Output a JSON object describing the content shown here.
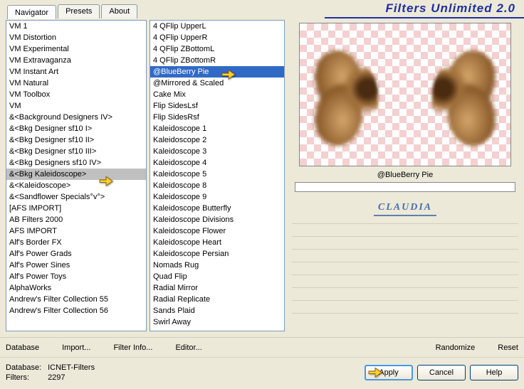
{
  "title": "Filters Unlimited 2.0",
  "tabs": [
    {
      "label": "Navigator",
      "active": true
    },
    {
      "label": "Presets",
      "active": false
    },
    {
      "label": "About",
      "active": false
    }
  ],
  "categories": [
    "VM 1",
    "VM Distortion",
    "VM Experimental",
    "VM Extravaganza",
    "VM Instant Art",
    "VM Natural",
    "VM Toolbox",
    "VM",
    "&<Background Designers IV>",
    "&<Bkg Designer sf10 I>",
    "&<Bkg Designer sf10 II>",
    "&<Bkg Designer sf10 III>",
    "&<Bkg Designers sf10 IV>",
    "&<Bkg Kaleidoscope>",
    "&<Kaleidoscope>",
    "&<Sandflower Specials°v°>",
    "[AFS IMPORT]",
    "AB Filters 2000",
    "AFS IMPORT",
    "Alf's Border FX",
    "Alf's Power Grads",
    "Alf's Power Sines",
    "Alf's Power Toys",
    "AlphaWorks",
    "Andrew's Filter Collection 55",
    "Andrew's Filter Collection 56"
  ],
  "category_selected_index": 13,
  "filters": [
    "4 QFlip UpperL",
    "4 QFlip UpperR",
    "4 QFlip ZBottomL",
    "4 QFlip ZBottomR",
    "@BlueBerry Pie",
    "@Mirrored & Scaled",
    "Cake Mix",
    "Flip SidesLsf",
    "Flip SidesRsf",
    "Kaleidoscope 1",
    "Kaleidoscope 2",
    "Kaleidoscope 3",
    "Kaleidoscope 4",
    "Kaleidoscope 5",
    "Kaleidoscope 8",
    "Kaleidoscope 9",
    "Kaleidoscope Butterfly",
    "Kaleidoscope Divisions",
    "Kaleidoscope Flower",
    "Kaleidoscope Heart",
    "Kaleidoscope Persian",
    "Nomads Rug",
    "Quad Flip",
    "Radial Mirror",
    "Radial Replicate",
    "Sands Plaid",
    "Swirl Away"
  ],
  "filter_selected_index": 4,
  "preview_label": "@BlueBerry Pie",
  "logo_text": "CLAUDIA",
  "toolbar": {
    "database": "Database",
    "import": "Import...",
    "filter_info": "Filter Info...",
    "editor": "Editor...",
    "randomize": "Randomize",
    "reset": "Reset"
  },
  "footer": {
    "db_label": "Database:",
    "db_value": "ICNET-Filters",
    "filters_label": "Filters:",
    "filters_value": "2297"
  },
  "buttons": {
    "apply": "Apply",
    "cancel": "Cancel",
    "help": "Help"
  }
}
